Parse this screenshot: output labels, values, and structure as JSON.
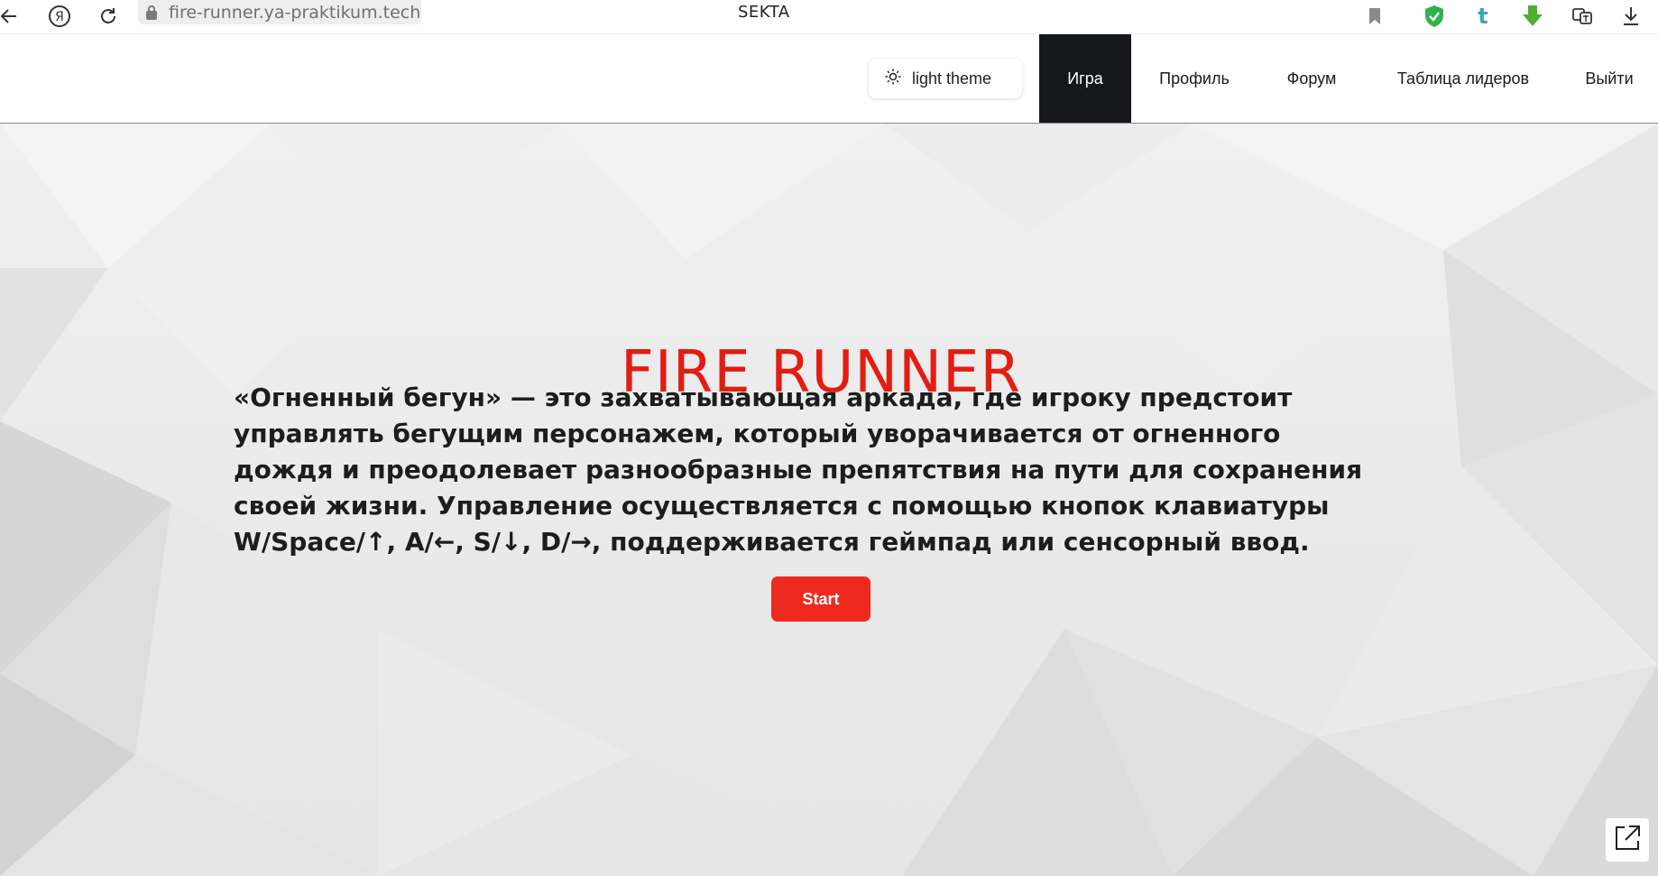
{
  "browser": {
    "url": "fire-runner.ya-praktikum.tech",
    "tab_title": "SEKTA",
    "icons": [
      "back-arrow-icon",
      "yandex-logo-icon",
      "reload-icon",
      "lock-icon",
      "bookmark-icon",
      "shield-extension-icon",
      "tumblr-extension-icon",
      "download-extension-icon",
      "translate-extension-icon",
      "downloads-icon"
    ]
  },
  "header": {
    "theme_toggle": {
      "label": "light theme",
      "icon": "sun-icon"
    },
    "nav": [
      {
        "label": "Игра",
        "active": true
      },
      {
        "label": "Профиль",
        "active": false
      },
      {
        "label": "Форум",
        "active": false
      },
      {
        "label": "Таблица лидеров",
        "active": false
      },
      {
        "label": "Выйти",
        "active": false
      }
    ]
  },
  "hero": {
    "title": "FIRE RUNNER",
    "description": "«Огненный бегун» — это захватывающая аркада, где игроку предстоит управлять бегущим персонажем, который уворачивается от огненного дождя и преодолевает разнообразные препятствия на пути для сохранения своей жизни. Управление осуществляется с помощью кнопок клавиатуры W/Space/↑, A/←, S/↓, D/→, поддерживается геймпад или сенсорный ввод.",
    "start_label": "Start"
  },
  "fullscreen_control": {
    "icon": "expand-icon"
  },
  "colors": {
    "accent_red": "#e21d12",
    "button_red": "#ee2a1f",
    "active_nav_bg": "#15171a",
    "hero_bg": "#ececec"
  }
}
